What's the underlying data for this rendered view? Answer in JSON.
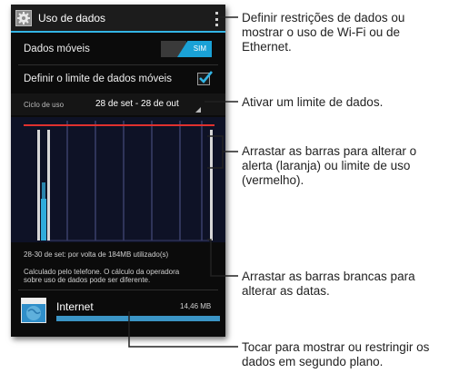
{
  "phone": {
    "actionbar": {
      "title": "Uso de dados",
      "accent": "#33b5e5"
    },
    "mobile_data": {
      "label": "Dados móveis",
      "toggle_on_text": "SIM",
      "enabled": true
    },
    "limit": {
      "label": "Definir o limite de dados móveis",
      "checked": true
    },
    "cycle": {
      "label": "Ciclo de uso",
      "value": "28 de set - 28 de out"
    },
    "usage_summary": "28-30 de set: por volta de 184MB utilizado(s)",
    "disclaimer": [
      "Calculado pelo telefone. O cálculo da operadora",
      "sobre uso de dados pode ser diferente."
    ],
    "apps": [
      {
        "name": "Internet",
        "size": "14,46 MB",
        "share": 1.0
      }
    ],
    "colors": {
      "limit_line": "#e0312e",
      "usage_fill": "#33b5e5",
      "grid": "#3a3f6a"
    }
  },
  "callouts": [
    {
      "lines": [
        "Definir restrições de dados ou",
        "mostrar o uso de Wi-Fi ou de",
        "Ethernet."
      ]
    },
    {
      "lines": [
        "Ativar um limite de dados."
      ]
    },
    {
      "lines": [
        "Arrastar as barras para alterar o",
        "alerta (laranja) ou limite de uso",
        "(vermelho)."
      ]
    },
    {
      "lines": [
        "Arrastar as barras brancas para",
        "alterar as datas."
      ]
    },
    {
      "lines": [
        "Tocar para mostrar ou restringir os",
        "dados em segundo plano."
      ]
    }
  ]
}
